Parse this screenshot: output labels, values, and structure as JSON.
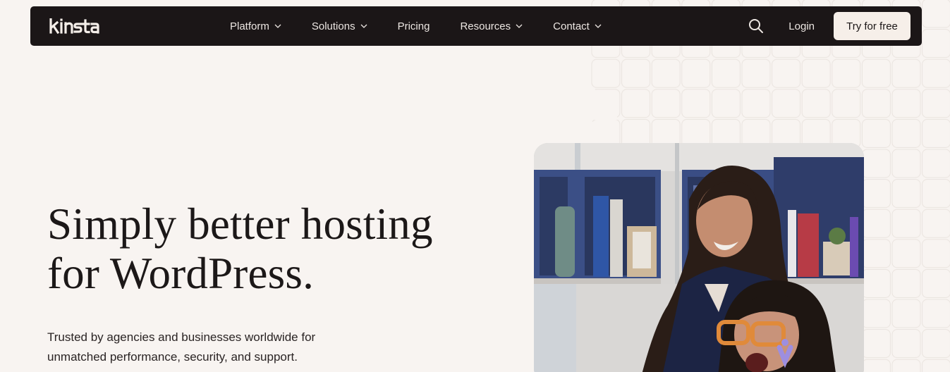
{
  "nav": {
    "brand": "Kinsta",
    "items": [
      {
        "label": "Platform",
        "has_dropdown": true
      },
      {
        "label": "Solutions",
        "has_dropdown": true
      },
      {
        "label": "Pricing",
        "has_dropdown": false
      },
      {
        "label": "Resources",
        "has_dropdown": true
      },
      {
        "label": "Contact",
        "has_dropdown": true
      }
    ],
    "search_icon": "search-icon",
    "login_label": "Login",
    "cta_label": "Try for free"
  },
  "hero": {
    "title_line1": "Simply better hosting",
    "title_line2": "for WordPress.",
    "subtitle_line1": "Trusted by agencies and businesses worldwide for",
    "subtitle_line2": "unmatched performance, security, and support."
  },
  "colors": {
    "background": "#f8f4f1",
    "navbar": "#1b1617",
    "cta_bg": "#f6efe9",
    "text": "#1c1818"
  }
}
